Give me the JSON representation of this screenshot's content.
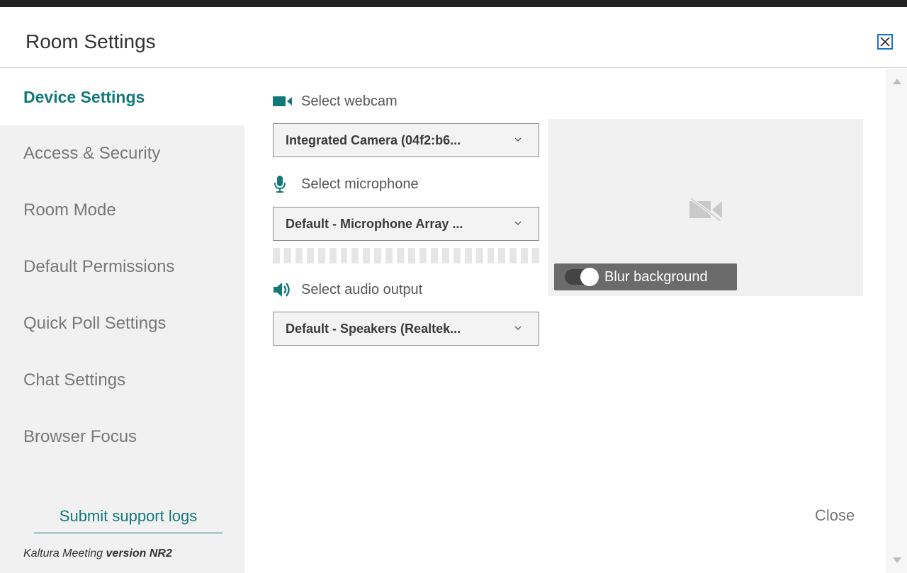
{
  "dialog": {
    "title": "Room Settings",
    "close_button": "Close"
  },
  "sidebar": {
    "items": [
      {
        "label": "Device Settings",
        "active": true
      },
      {
        "label": "Access & Security",
        "active": false
      },
      {
        "label": "Room Mode",
        "active": false
      },
      {
        "label": "Default Permissions",
        "active": false
      },
      {
        "label": "Quick Poll Settings",
        "active": false
      },
      {
        "label": "Chat Settings",
        "active": false
      },
      {
        "label": "Browser Focus",
        "active": false
      }
    ],
    "support_link": "Submit support logs",
    "version_prefix": "Kaltura Meeting",
    "version_value": "version NR2"
  },
  "devices": {
    "webcam": {
      "label": "Select webcam",
      "value": "Integrated Camera (04f2:b6..."
    },
    "microphone": {
      "label": "Select microphone",
      "value": "Default - Microphone Array ..."
    },
    "audio_output": {
      "label": "Select audio output",
      "value": "Default - Speakers (Realtek..."
    }
  },
  "preview": {
    "blur_label": "Blur background",
    "blur_enabled": true
  },
  "icons": {
    "webcam": "video-camera-icon",
    "microphone": "microphone-icon",
    "audio": "speaker-icon",
    "camera_off": "camera-off-icon"
  },
  "colors": {
    "accent": "#12787a",
    "close_border": "#1a73c8"
  }
}
